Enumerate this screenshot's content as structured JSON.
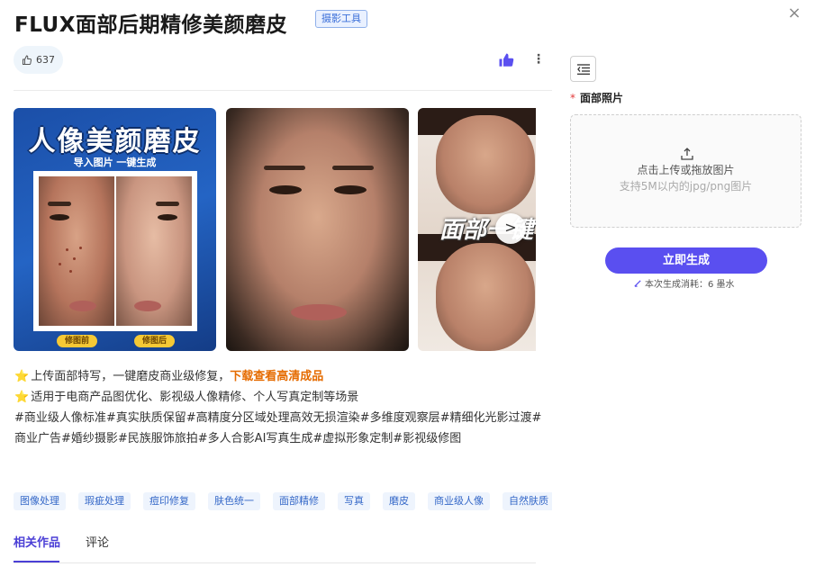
{
  "header": {
    "title": "FLUX面部后期精修美颜磨皮",
    "badge": "摄影工具",
    "close_symbol": "×"
  },
  "actions": {
    "likes": "637",
    "more_symbol": "⋮"
  },
  "gallery": {
    "image1": {
      "title": "人像美颜磨皮",
      "subtitle": "导入图片 一键生成",
      "before_label": "修图前",
      "after_label": "修图后"
    },
    "image3": {
      "overlay_text": "面部一键"
    },
    "next_symbol": ">"
  },
  "description": {
    "star": "⭐",
    "line1": "上传面部特写，一键磨皮商业级修复，",
    "line1_link": "下载查看高清成品",
    "line2": "适用于电商产品图优化、影视级人像精修、个人写真定制等场景",
    "hashtags": "#商业级人像标准#真实肤质保留#高精度分区域处理高效无损渲染#多维度观察层#精细化光影过渡#商业广告#婚纱摄影#民族服饰旅拍#多人合影AI写真生成#虚拟形象定制#影视级修图"
  },
  "tags": [
    "图像处理",
    "瑕疵处理",
    "痘印修复",
    "肤色统一",
    "面部精修",
    "写真",
    "磨皮",
    "商业级人像",
    "自然肤质"
  ],
  "tabs": [
    {
      "label": "相关作品"
    },
    {
      "label": "评论"
    }
  ],
  "form": {
    "field_label": "面部照片",
    "required_mark": "*",
    "upload_main": "点击上传或拖放图片",
    "upload_hint": "支持5M以内的jpg/png图片",
    "generate_label": "立即生成",
    "cost_text": "本次生成消耗：6 墨水"
  },
  "colors": {
    "accent": "#5a4ff0",
    "tag_text": "#3568c8",
    "link": "#e56b00"
  },
  "icons": {
    "like": "thumbs-up-outline-icon",
    "thumb": "thumbs-up-filled-icon",
    "upload": "upload-arrow-icon",
    "collapse": "collapse-panel-icon",
    "ink": "ink-pen-icon"
  }
}
